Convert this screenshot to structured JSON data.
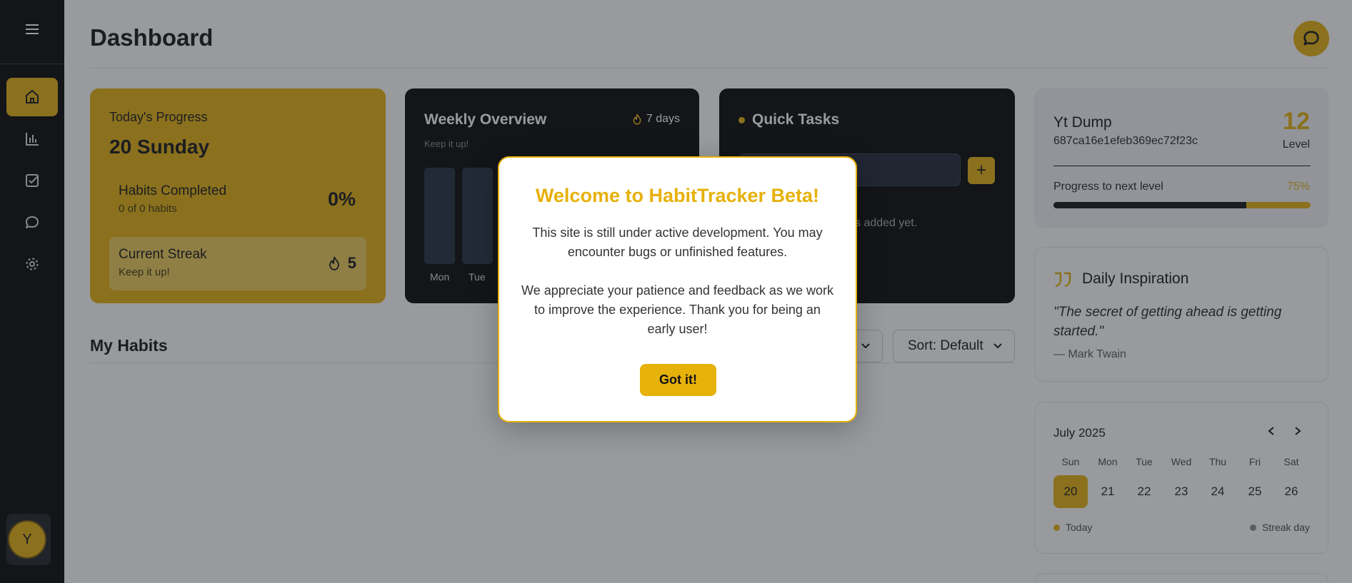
{
  "header": {
    "title": "Dashboard"
  },
  "progress": {
    "label": "Today's Progress",
    "day": "20 Sunday",
    "habits_title": "Habits Completed",
    "habits_sub": "0 of 0 habits",
    "habits_pct": "0%",
    "streak_title": "Current Streak",
    "streak_sub": "Keep it up!",
    "streak_value": "5"
  },
  "weekly": {
    "title": "Weekly Overview",
    "subtitle": "Keep it up!",
    "days_label": "7 days",
    "bars": [
      "Mon",
      "Tue"
    ]
  },
  "tasks": {
    "title": "Quick Tasks",
    "add_label": "+",
    "empty_text": "s added yet."
  },
  "habits": {
    "title": "My Habits",
    "sort_label": "Sort: Default"
  },
  "profile": {
    "name": "Yt Dump",
    "id": "687ca16e1efeb369ec72f23c",
    "level_num": "12",
    "level_label": "Level",
    "progress_label": "Progress to next level",
    "progress_pct": "75%",
    "progress_value": 0.75
  },
  "inspiration": {
    "title": "Daily Inspiration",
    "quote": "\"The secret of getting ahead is getting started.\"",
    "author": "— Mark Twain"
  },
  "calendar": {
    "month": "July 2025",
    "headers": [
      "Sun",
      "Mon",
      "Tue",
      "Wed",
      "Thu",
      "Fri",
      "Sat"
    ],
    "days": [
      "20",
      "21",
      "22",
      "23",
      "24",
      "25",
      "26"
    ],
    "legend_today": "Today",
    "legend_streak": "Streak day"
  },
  "sidebar": {
    "avatar_letter": "Y"
  },
  "modal": {
    "title": "Welcome to HabitTracker Beta!",
    "para1": "This site is still under active development. You may encounter bugs or unfinished features.",
    "para2": "We appreciate your patience and feedback as we work to improve the experience. Thank you for being an early user!",
    "button": "Got it!"
  },
  "colors": {
    "accent": "#e6b10a",
    "sidebar": "#000000",
    "dark_card": "#000000"
  }
}
